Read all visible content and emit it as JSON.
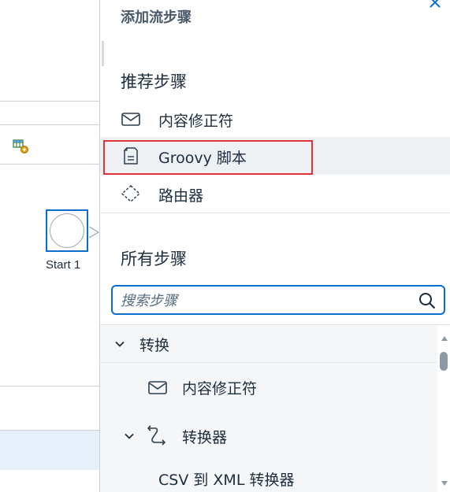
{
  "canvas": {
    "start_label": "Start 1"
  },
  "panel": {
    "title": "添加流步骤",
    "recommended_heading": "推荐步骤",
    "recommended_items": [
      {
        "label": "内容修正符",
        "icon": "envelope-icon"
      },
      {
        "label": "Groovy 脚本",
        "icon": "script-file-icon"
      },
      {
        "label": "路由器",
        "icon": "router-diamond-icon"
      }
    ],
    "all_heading": "所有步骤",
    "search": {
      "placeholder": "搜索步骤",
      "value": ""
    },
    "tree": {
      "group_transform": "转换",
      "content_modifier": "内容修正符",
      "converter": "转换器",
      "csv_to_xml": "CSV 到 XML 转换器"
    }
  },
  "colors": {
    "accent": "#0a6ed1",
    "highlight": "#e0333a",
    "text": "#1d2d3e"
  }
}
